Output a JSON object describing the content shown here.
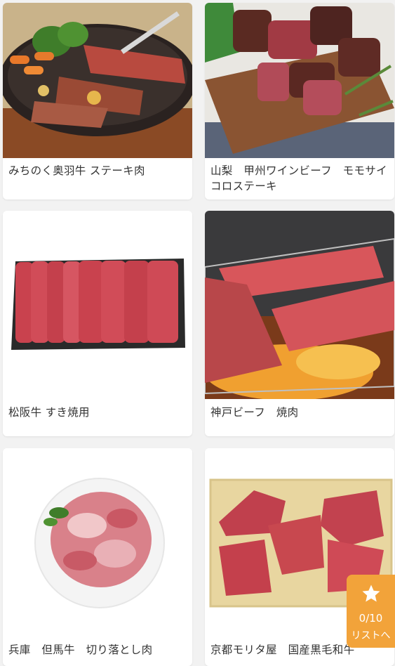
{
  "products": [
    {
      "title": "みちのく奥羽牛 ステーキ肉",
      "image": "steak-on-skillet-photo"
    },
    {
      "title": "山梨　甲州ワインビーフ　モモサイコロステーキ",
      "image": "diced-steak-on-board-photo"
    },
    {
      "title": "松阪牛 すき焼用",
      "image": "sukiyaki-slices-tray-photo"
    },
    {
      "title": "神戸ビーフ　焼肉",
      "image": "beef-on-grill-photo"
    },
    {
      "title": "兵庫　但馬牛　切り落とし肉",
      "image": "beef-scraps-plate-photo"
    },
    {
      "title": "京都モリタ屋　国産黒毛和牛",
      "image": "beef-in-gift-box-photo"
    }
  ],
  "favorite_list": {
    "count": "0/10",
    "label": "リストへ",
    "icon": "star-icon",
    "color": "#f2a33a"
  }
}
